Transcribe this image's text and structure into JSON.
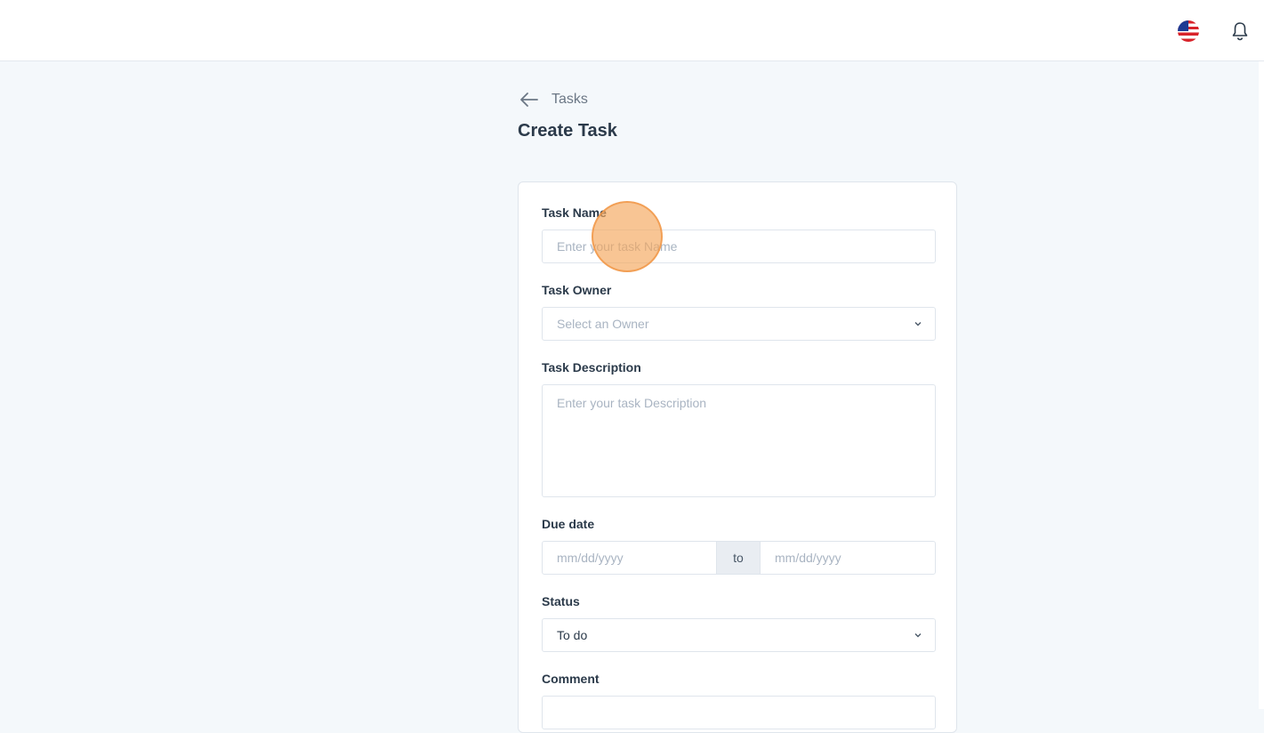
{
  "header": {
    "language_icon": "us-flag-icon",
    "notification_icon": "bell-icon"
  },
  "breadcrumb": {
    "back_icon": "arrow-left-icon",
    "label": "Tasks"
  },
  "page": {
    "title": "Create Task"
  },
  "form": {
    "task_name": {
      "label": "Task Name",
      "placeholder": "Enter your task Name"
    },
    "task_owner": {
      "label": "Task Owner",
      "placeholder": "Select an Owner"
    },
    "task_description": {
      "label": "Task Description",
      "placeholder": "Enter your task Description"
    },
    "due_date": {
      "label": "Due date",
      "from_placeholder": "mm/dd/yyyy",
      "separator": "to",
      "to_placeholder": "mm/dd/yyyy"
    },
    "status": {
      "label": "Status",
      "value": "To do"
    },
    "comment": {
      "label": "Comment"
    }
  },
  "colors": {
    "background": "#f4f8fb",
    "click_marker": "#f5a65a"
  }
}
